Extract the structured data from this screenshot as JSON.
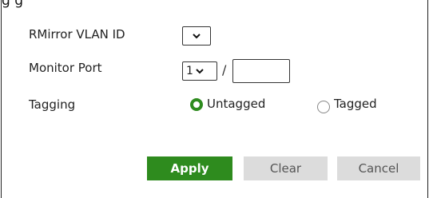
{
  "header_fragment": "g                                                                     g",
  "form": {
    "rmirror_vlan_label": "RMirror VLAN ID",
    "rmirror_vlan_value": "",
    "monitor_port_label": "Monitor Port",
    "monitor_port_slot": "1",
    "monitor_port_separator": "/",
    "monitor_port_value": "",
    "tagging_label": "Tagging",
    "tagging_options": [
      {
        "label": "Untagged",
        "selected": true
      },
      {
        "label": "Tagged",
        "selected": false
      }
    ]
  },
  "buttons": {
    "apply": "Apply",
    "clear": "Clear",
    "cancel": "Cancel"
  },
  "colors": {
    "accent": "#2e8b1e",
    "secondary_button": "#dcdcdc"
  }
}
